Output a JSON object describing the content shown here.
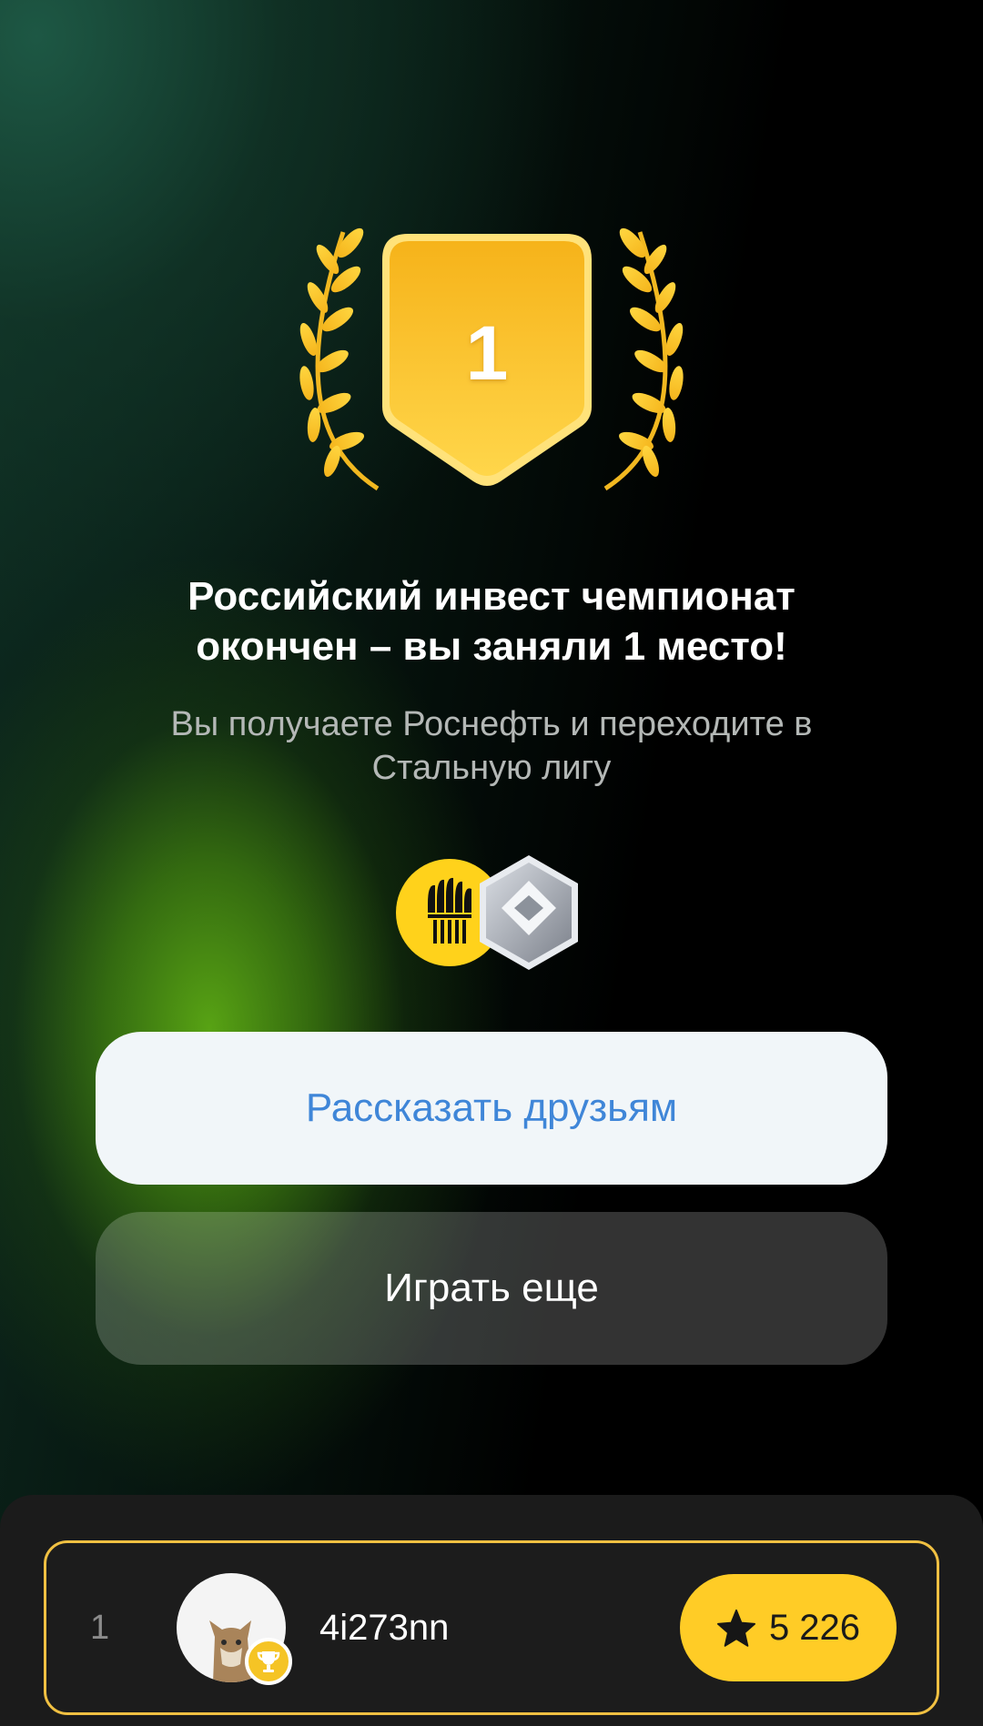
{
  "result": {
    "rank": "1",
    "title_line1": "Российский инвест чемпионат",
    "title_line2": "окончен – вы заняли 1 место!",
    "subtitle_line1": "Вы получаете Роснефть и переходите в",
    "subtitle_line2": "Стальную лигу"
  },
  "rewards": {
    "icons": [
      "rosneft-logo-icon",
      "steel-league-badge-icon"
    ]
  },
  "buttons": {
    "share_label": "Рассказать друзьям",
    "play_again_label": "Играть еще"
  },
  "leaderboard": {
    "place": "1",
    "username": "4i273nn",
    "score": "5 226"
  },
  "colors": {
    "accent_gold": "#FFCC26",
    "link_blue": "#3F86D8",
    "row_border": "#F0C042"
  }
}
